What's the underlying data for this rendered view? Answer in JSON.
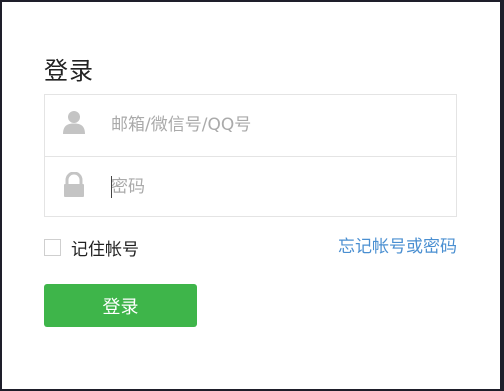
{
  "login": {
    "title": "登录",
    "account_field": {
      "icon": "user-icon",
      "placeholder": "邮箱/微信号/QQ号",
      "value": ""
    },
    "password_field": {
      "icon": "lock-icon",
      "placeholder": "密码",
      "value": ""
    },
    "remember": {
      "label": "记住帐号",
      "checked": false
    },
    "forgot_link": "忘记帐号或密码",
    "submit_label": "登录"
  },
  "colors": {
    "accent_green": "#3eb54a",
    "link_blue": "#4a8fd1",
    "icon_gray": "#c4c4c4",
    "border_gray": "#e4e4e4"
  }
}
